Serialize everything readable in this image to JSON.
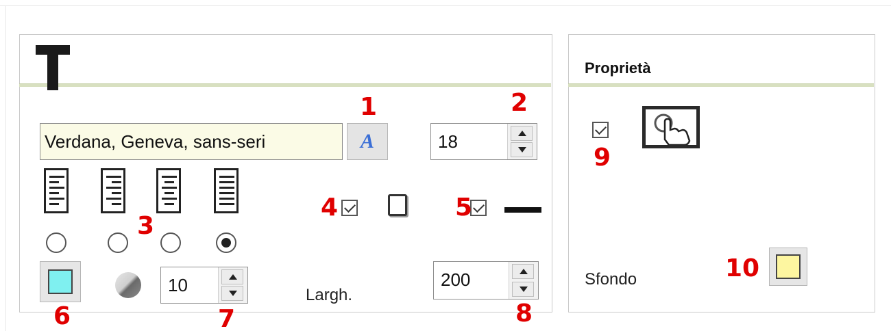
{
  "text_panel": {
    "font_family_value": "Verdana, Geneva, sans-seri",
    "font_size_value": "18",
    "line_opacity_value": "10",
    "width_label": "Largh.",
    "width_value": "200"
  },
  "properties_panel": {
    "title": "Proprietà",
    "background_label": "Sfondo"
  },
  "callouts": [
    "1",
    "2",
    "3",
    "4",
    "5",
    "6",
    "7",
    "8",
    "9",
    "10"
  ],
  "colors": {
    "text_color_swatch": "#7ff0f0",
    "background_swatch": "#fdf6a0",
    "callout_red": "#e00000",
    "separator": "#d8e0c0"
  },
  "icons": {
    "text_tool": "big-t-icon",
    "font_picker": "font-style-icon",
    "alignment": [
      "align-left-icon",
      "align-right-icon",
      "align-center-icon",
      "align-justify-icon"
    ],
    "border_box": "square-outline-icon",
    "border_line": "line-icon",
    "opacity": "opacity-icon",
    "interactive": "touch-icon"
  }
}
